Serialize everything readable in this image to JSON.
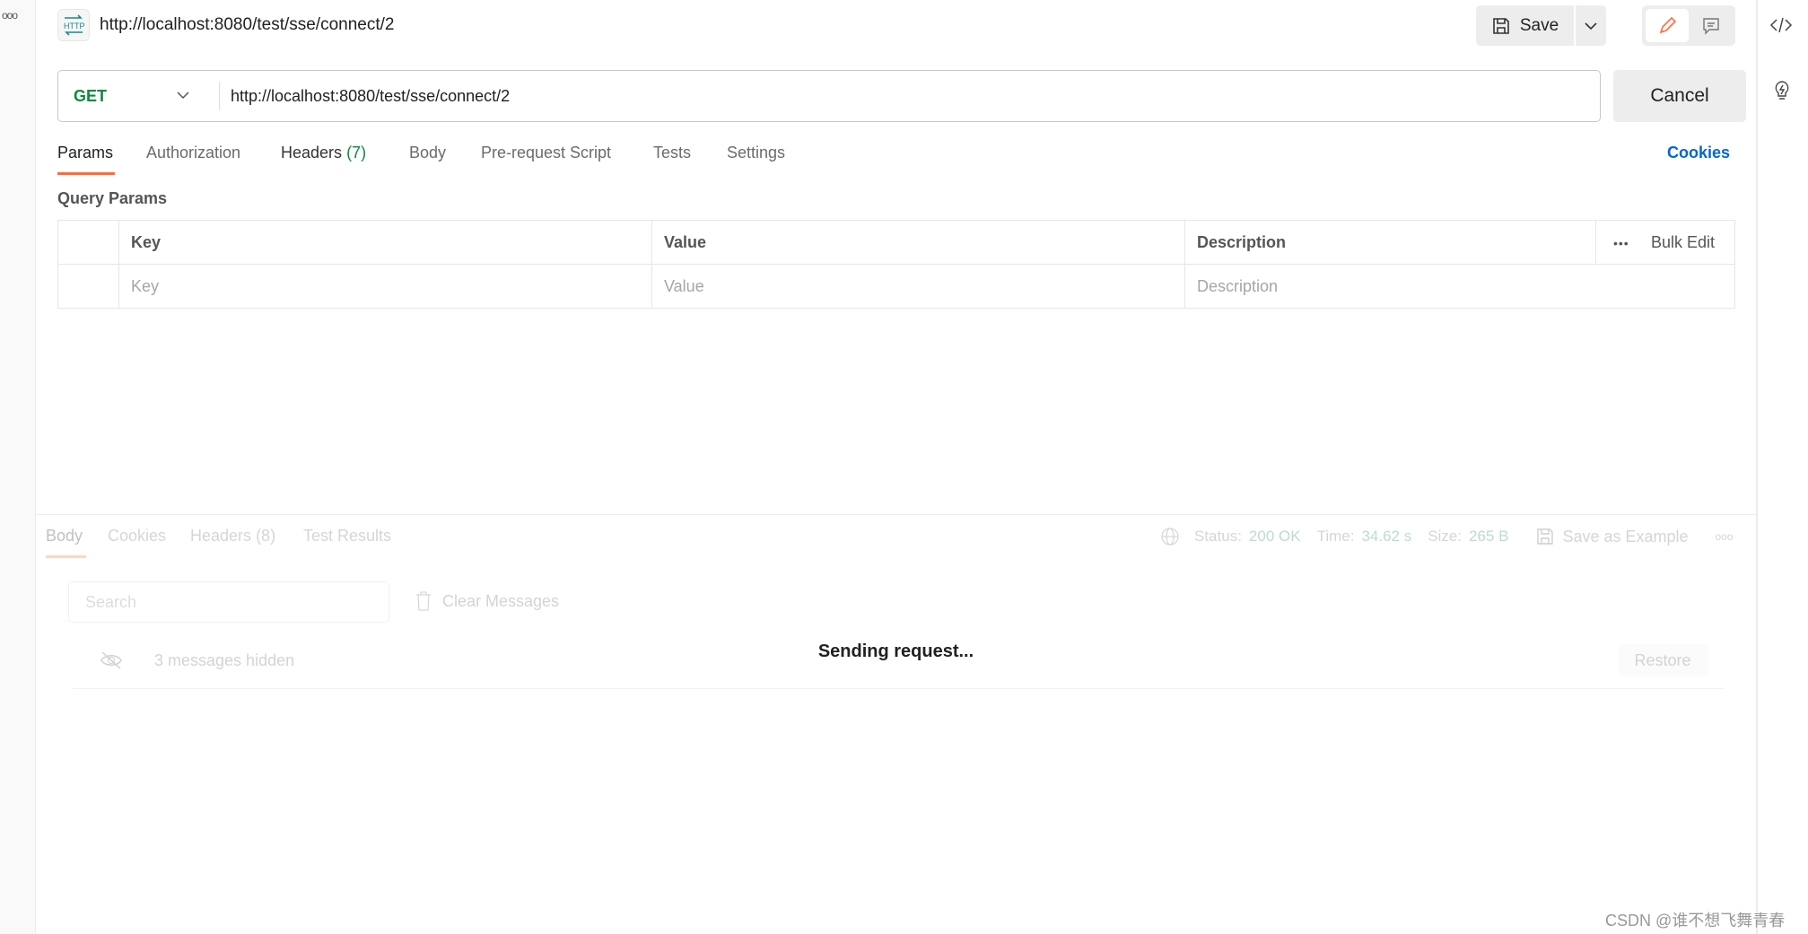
{
  "header": {
    "title": "http://localhost:8080/test/sse/connect/2",
    "icon": "http-icon",
    "save_label": "Save"
  },
  "request": {
    "method": "GET",
    "url": "http://localhost:8080/test/sse/connect/2",
    "cancel_label": "Cancel",
    "method_color": "#0b8a3e"
  },
  "tabs": {
    "params": "Params",
    "authorization": "Authorization",
    "headers": "Headers",
    "headers_count": "(7)",
    "body": "Body",
    "prerequest": "Pre-request Script",
    "tests": "Tests",
    "settings": "Settings",
    "cookies": "Cookies",
    "active": "Params",
    "accent": "#ff6c37"
  },
  "query": {
    "title": "Query Params",
    "columns": [
      "Key",
      "Value",
      "Description"
    ],
    "bulk_edit": "Bulk Edit",
    "placeholders": {
      "key": "Key",
      "value": "Value",
      "description": "Description"
    }
  },
  "response": {
    "tabs": {
      "body": "Body",
      "cookies": "Cookies",
      "headers": "Headers",
      "headers_count": "(8)",
      "test_results": "Test Results"
    },
    "status_label": "Status:",
    "status_value": "200 OK",
    "time_label": "Time:",
    "time_value": "34.62 s",
    "size_label": "Size:",
    "size_value": "265 B",
    "save_example": "Save as Example",
    "search_placeholder": "Search",
    "clear_messages": "Clear Messages",
    "hidden_messages": "3 messages hidden",
    "restore": "Restore"
  },
  "overlay": {
    "sending": "Sending request..."
  },
  "watermark": "CSDN @谁不想飞舞青春"
}
